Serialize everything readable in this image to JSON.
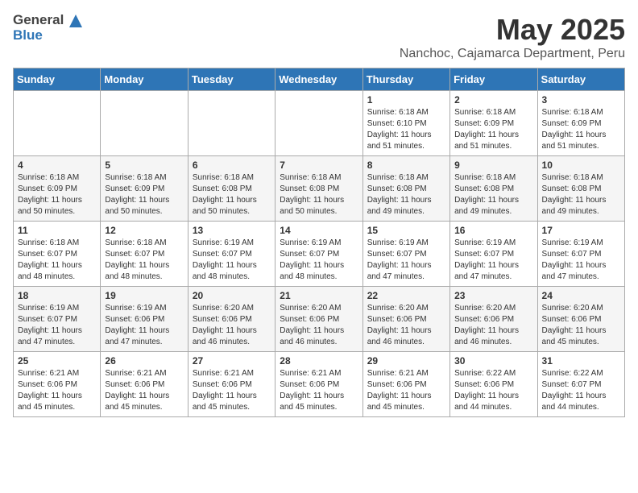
{
  "header": {
    "logo_general": "General",
    "logo_blue": "Blue",
    "title": "May 2025",
    "subtitle": "Nanchoc, Cajamarca Department, Peru"
  },
  "days_of_week": [
    "Sunday",
    "Monday",
    "Tuesday",
    "Wednesday",
    "Thursday",
    "Friday",
    "Saturday"
  ],
  "weeks": [
    [
      {
        "day": "",
        "info": ""
      },
      {
        "day": "",
        "info": ""
      },
      {
        "day": "",
        "info": ""
      },
      {
        "day": "",
        "info": ""
      },
      {
        "day": "1",
        "info": "Sunrise: 6:18 AM\nSunset: 6:10 PM\nDaylight: 11 hours\nand 51 minutes."
      },
      {
        "day": "2",
        "info": "Sunrise: 6:18 AM\nSunset: 6:09 PM\nDaylight: 11 hours\nand 51 minutes."
      },
      {
        "day": "3",
        "info": "Sunrise: 6:18 AM\nSunset: 6:09 PM\nDaylight: 11 hours\nand 51 minutes."
      }
    ],
    [
      {
        "day": "4",
        "info": "Sunrise: 6:18 AM\nSunset: 6:09 PM\nDaylight: 11 hours\nand 50 minutes."
      },
      {
        "day": "5",
        "info": "Sunrise: 6:18 AM\nSunset: 6:09 PM\nDaylight: 11 hours\nand 50 minutes."
      },
      {
        "day": "6",
        "info": "Sunrise: 6:18 AM\nSunset: 6:08 PM\nDaylight: 11 hours\nand 50 minutes."
      },
      {
        "day": "7",
        "info": "Sunrise: 6:18 AM\nSunset: 6:08 PM\nDaylight: 11 hours\nand 50 minutes."
      },
      {
        "day": "8",
        "info": "Sunrise: 6:18 AM\nSunset: 6:08 PM\nDaylight: 11 hours\nand 49 minutes."
      },
      {
        "day": "9",
        "info": "Sunrise: 6:18 AM\nSunset: 6:08 PM\nDaylight: 11 hours\nand 49 minutes."
      },
      {
        "day": "10",
        "info": "Sunrise: 6:18 AM\nSunset: 6:08 PM\nDaylight: 11 hours\nand 49 minutes."
      }
    ],
    [
      {
        "day": "11",
        "info": "Sunrise: 6:18 AM\nSunset: 6:07 PM\nDaylight: 11 hours\nand 48 minutes."
      },
      {
        "day": "12",
        "info": "Sunrise: 6:18 AM\nSunset: 6:07 PM\nDaylight: 11 hours\nand 48 minutes."
      },
      {
        "day": "13",
        "info": "Sunrise: 6:19 AM\nSunset: 6:07 PM\nDaylight: 11 hours\nand 48 minutes."
      },
      {
        "day": "14",
        "info": "Sunrise: 6:19 AM\nSunset: 6:07 PM\nDaylight: 11 hours\nand 48 minutes."
      },
      {
        "day": "15",
        "info": "Sunrise: 6:19 AM\nSunset: 6:07 PM\nDaylight: 11 hours\nand 47 minutes."
      },
      {
        "day": "16",
        "info": "Sunrise: 6:19 AM\nSunset: 6:07 PM\nDaylight: 11 hours\nand 47 minutes."
      },
      {
        "day": "17",
        "info": "Sunrise: 6:19 AM\nSunset: 6:07 PM\nDaylight: 11 hours\nand 47 minutes."
      }
    ],
    [
      {
        "day": "18",
        "info": "Sunrise: 6:19 AM\nSunset: 6:07 PM\nDaylight: 11 hours\nand 47 minutes."
      },
      {
        "day": "19",
        "info": "Sunrise: 6:19 AM\nSunset: 6:06 PM\nDaylight: 11 hours\nand 47 minutes."
      },
      {
        "day": "20",
        "info": "Sunrise: 6:20 AM\nSunset: 6:06 PM\nDaylight: 11 hours\nand 46 minutes."
      },
      {
        "day": "21",
        "info": "Sunrise: 6:20 AM\nSunset: 6:06 PM\nDaylight: 11 hours\nand 46 minutes."
      },
      {
        "day": "22",
        "info": "Sunrise: 6:20 AM\nSunset: 6:06 PM\nDaylight: 11 hours\nand 46 minutes."
      },
      {
        "day": "23",
        "info": "Sunrise: 6:20 AM\nSunset: 6:06 PM\nDaylight: 11 hours\nand 46 minutes."
      },
      {
        "day": "24",
        "info": "Sunrise: 6:20 AM\nSunset: 6:06 PM\nDaylight: 11 hours\nand 45 minutes."
      }
    ],
    [
      {
        "day": "25",
        "info": "Sunrise: 6:21 AM\nSunset: 6:06 PM\nDaylight: 11 hours\nand 45 minutes."
      },
      {
        "day": "26",
        "info": "Sunrise: 6:21 AM\nSunset: 6:06 PM\nDaylight: 11 hours\nand 45 minutes."
      },
      {
        "day": "27",
        "info": "Sunrise: 6:21 AM\nSunset: 6:06 PM\nDaylight: 11 hours\nand 45 minutes."
      },
      {
        "day": "28",
        "info": "Sunrise: 6:21 AM\nSunset: 6:06 PM\nDaylight: 11 hours\nand 45 minutes."
      },
      {
        "day": "29",
        "info": "Sunrise: 6:21 AM\nSunset: 6:06 PM\nDaylight: 11 hours\nand 45 minutes."
      },
      {
        "day": "30",
        "info": "Sunrise: 6:22 AM\nSunset: 6:06 PM\nDaylight: 11 hours\nand 44 minutes."
      },
      {
        "day": "31",
        "info": "Sunrise: 6:22 AM\nSunset: 6:07 PM\nDaylight: 11 hours\nand 44 minutes."
      }
    ]
  ]
}
